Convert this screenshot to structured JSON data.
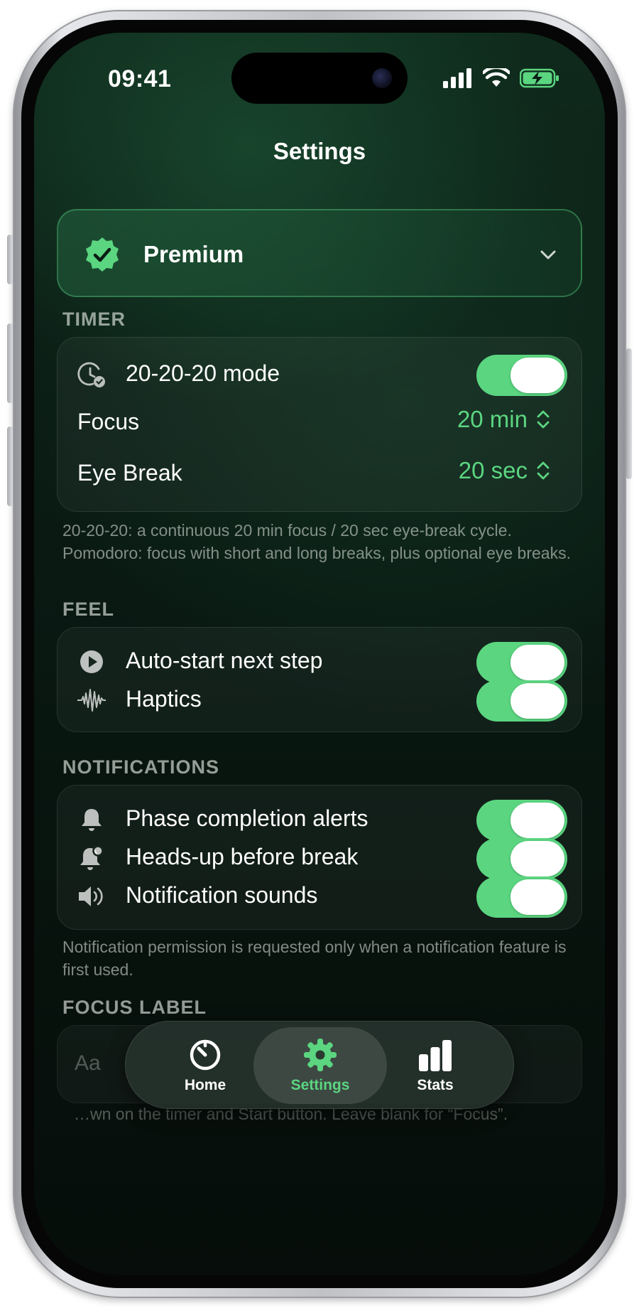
{
  "status_bar": {
    "time": "09:41"
  },
  "nav": {
    "title": "Settings"
  },
  "premium": {
    "label": "Premium"
  },
  "timer": {
    "header": "TIMER",
    "mode_label": "20-20-20 mode",
    "mode_enabled": true,
    "focus_label": "Focus",
    "focus_value": "20 min",
    "eye_break_label": "Eye Break",
    "eye_break_value": "20 sec",
    "footnote": "20-20-20: a continuous 20 min focus / 20 sec eye-break cycle. Pomodoro: focus with short and long breaks, plus optional eye breaks."
  },
  "feel": {
    "header": "FEEL",
    "items": [
      {
        "label": "Auto-start next step",
        "icon": "play-circle-icon",
        "enabled": true
      },
      {
        "label": "Haptics",
        "icon": "waveform-icon",
        "enabled": true
      }
    ]
  },
  "notifications": {
    "header": "NOTIFICATIONS",
    "items": [
      {
        "label": "Phase completion alerts",
        "icon": "bell-icon",
        "enabled": true
      },
      {
        "label": "Heads-up before break",
        "icon": "bell-badge-icon",
        "enabled": true
      },
      {
        "label": "Notification sounds",
        "icon": "speaker-icon",
        "enabled": true
      }
    ],
    "footnote": "Notification permission is requested only when a notification feature is first used."
  },
  "focus_label": {
    "header": "FOCUS LABEL",
    "input_prefix": "Aa",
    "footnote": "…wn on the timer and Start button. Leave blank for “Focus”."
  },
  "tab_bar": {
    "tabs": [
      {
        "label": "Home",
        "icon": "timer-icon",
        "active": false
      },
      {
        "label": "Settings",
        "icon": "gear-icon",
        "active": true
      },
      {
        "label": "Stats",
        "icon": "bar-chart-icon",
        "active": false
      }
    ]
  },
  "colors": {
    "accent": "#5bd580",
    "background": "#0b1d15"
  }
}
